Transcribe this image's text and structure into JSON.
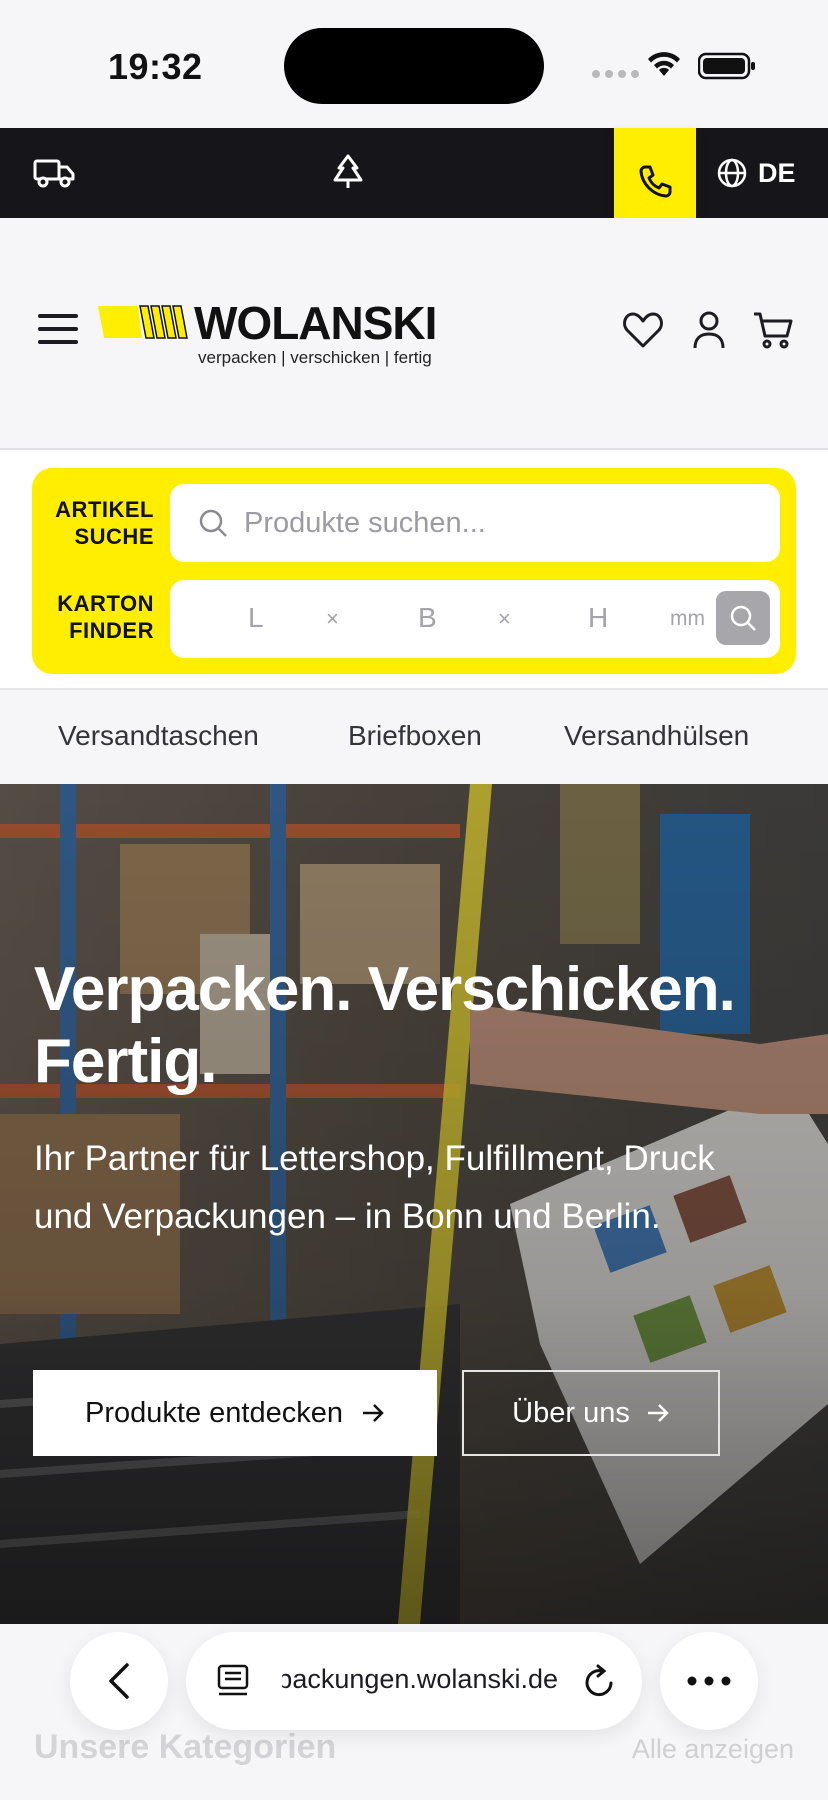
{
  "status_bar": {
    "time": "19:32"
  },
  "top_bar": {
    "icons": [
      "truck-icon",
      "tree-icon",
      "phone-icon",
      "globe-icon"
    ],
    "language": "DE",
    "accent": "#ffee00",
    "background": "#16161a"
  },
  "header": {
    "logo": {
      "brand": "WOLANSKI",
      "tagline": "verpacken | verschicken | fertig"
    },
    "icons": [
      "menu-icon",
      "heart-icon",
      "user-icon",
      "cart-icon"
    ]
  },
  "search": {
    "article_label_1": "ARTIKEL",
    "article_label_2": "SUCHE",
    "placeholder": "Produkte suchen...",
    "box_label_1": "KARTON",
    "box_label_2": "FINDER",
    "length": "L",
    "width": "B",
    "height": "H",
    "separator": "×",
    "unit": "mm"
  },
  "categories": [
    "Versandtaschen",
    "Briefboxen",
    "Versandhülsen"
  ],
  "hero": {
    "title_line1": "Verpacken. Verschicken.",
    "title_line2": "Fertig.",
    "subtitle": "Ihr Partner für Lettershop, Fulfillment, Druck und Verpackungen – in Bonn und Berlin.",
    "primary_button": "Produkte entdecken",
    "secondary_button": "Über uns"
  },
  "section": {
    "title": "Unsere Kategorien",
    "link": "Alle anzeigen"
  },
  "browser": {
    "url": "verpackungen.wolanski.de"
  }
}
